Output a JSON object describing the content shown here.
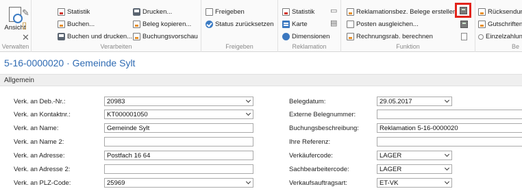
{
  "ribbon": {
    "groups": {
      "verwalten": {
        "label": "Verwalten",
        "ansicht": "Ansicht"
      },
      "verarbeiten": {
        "label": "Verarbeiten",
        "items": [
          "Statistik",
          "Buchen...",
          "Buchen und drucken...",
          "Drucken...",
          "Beleg kopieren...",
          "Buchungsvorschau"
        ]
      },
      "freigeben": {
        "label": "Freigeben",
        "items": [
          "Freigeben",
          "Status zurücksetzen"
        ]
      },
      "reklamation": {
        "label": "Reklamation",
        "items": [
          "Statistik",
          "Karte",
          "Dimensionen"
        ]
      },
      "funktion": {
        "label": "Funktion",
        "items": [
          "Reklamationsbez. Belege erstellen...",
          "Posten ausgleichen...",
          "Rechnungsrab. berechnen"
        ]
      },
      "next": {
        "label": "Be",
        "items": [
          "Rücksendung",
          "Gutschriften",
          "Einzelzahlung"
        ]
      }
    }
  },
  "page_title": "5-16-0000020 · Gemeinde Sylt",
  "section_title": "Allgemein",
  "form": {
    "left": [
      {
        "label": "Verk. an Deb.-Nr.:",
        "value": "20983",
        "dropdown": true
      },
      {
        "label": "Verk. an Kontaktnr.:",
        "value": "KT000001050",
        "dropdown": true
      },
      {
        "label": "Verk. an Name:",
        "value": "Gemeinde Sylt",
        "dropdown": false
      },
      {
        "label": "Verk. an Name 2:",
        "value": "",
        "dropdown": false
      },
      {
        "label": "Verk. an Adresse:",
        "value": "Postfach 16 64",
        "dropdown": false
      },
      {
        "label": "Verk. an Adresse 2:",
        "value": "",
        "dropdown": false
      },
      {
        "label": "Verk. an PLZ-Code:",
        "value": "25969",
        "dropdown": true
      }
    ],
    "right": [
      {
        "label": "Belegdatum:",
        "value": "29.05.2017",
        "dropdown": true
      },
      {
        "label": "Externe Belegnummer:",
        "value": "",
        "dropdown": false
      },
      {
        "label": "Buchungsbeschreibung:",
        "value": "Reklamation 5-16-0000020",
        "dropdown": false
      },
      {
        "label": "Ihre Referenz:",
        "value": "",
        "dropdown": false
      },
      {
        "label": "Verkäufercode:",
        "value": "LAGER",
        "dropdown": true
      },
      {
        "label": "Sachbearbeitercode:",
        "value": "LAGER",
        "dropdown": true
      },
      {
        "label": "Verkaufsauftragsart:",
        "value": "ET-VK",
        "dropdown": true
      }
    ]
  },
  "colors": {
    "title": "#2f6bb3",
    "highlight": "#e2231a"
  }
}
